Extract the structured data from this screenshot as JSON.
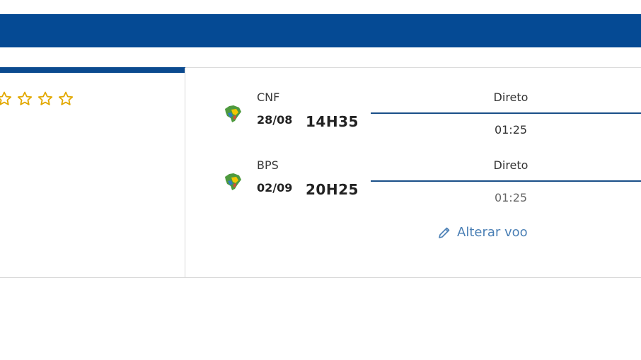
{
  "colors": {
    "topbar": "#054a94",
    "accent": "#0b4a8f",
    "star": "#e2a800",
    "link": "#4a7fb5"
  },
  "rating": {
    "stars": 4
  },
  "flights": [
    {
      "airport": "CNF",
      "date": "28/08",
      "time": "14H35",
      "route": "Direto",
      "duration": "01:25",
      "icon": "brazil-map-icon"
    },
    {
      "airport": "BPS",
      "date": "02/09",
      "time": "20H25",
      "route": "Direto",
      "duration": "01:25",
      "icon": "brazil-map-icon"
    }
  ],
  "actions": {
    "change_flight": "Alterar voo",
    "edit_icon": "pencil-icon"
  }
}
